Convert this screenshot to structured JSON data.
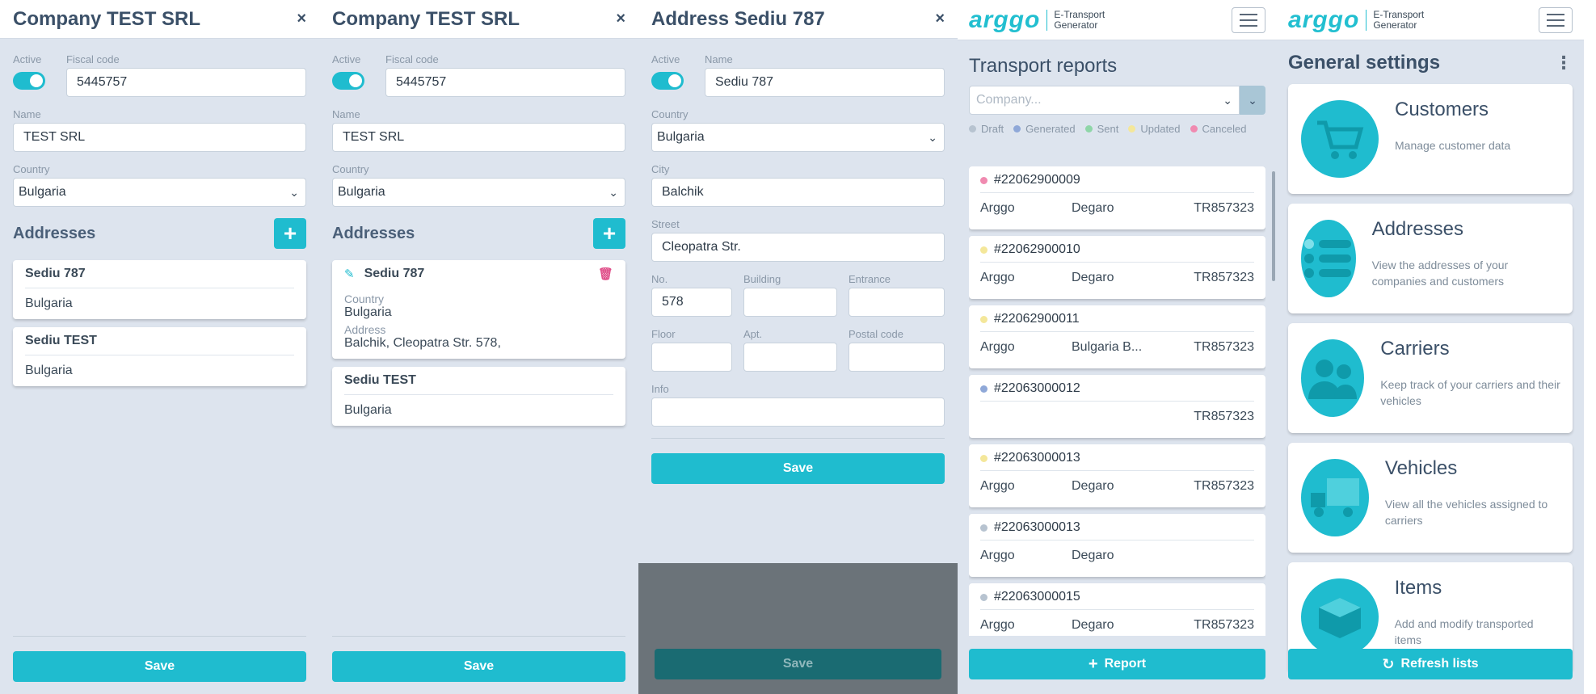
{
  "panel1": {
    "title": "Company TEST SRL",
    "close": "×",
    "active_label": "Active",
    "fiscal_label": "Fiscal code",
    "fiscal_value": "5445757",
    "name_label": "Name",
    "name_value": "TEST SRL",
    "country_label": "Country",
    "country_value": "Bulgaria",
    "addresses_label": "Addresses",
    "addresses": [
      {
        "title": "Sediu 787",
        "country": "Bulgaria"
      },
      {
        "title": "Sediu TEST",
        "country": "Bulgaria"
      }
    ],
    "save_label": "Save"
  },
  "panel2": {
    "title": "Company TEST SRL",
    "close": "×",
    "active_label": "Active",
    "fiscal_label": "Fiscal code",
    "fiscal_value": "5445757",
    "name_label": "Name",
    "name_value": "TEST SRL",
    "country_label": "Country",
    "country_value": "Bulgaria",
    "addresses_label": "Addresses",
    "expanded": {
      "title": "Sediu 787",
      "country_label": "Country",
      "country_value": "Bulgaria",
      "address_label": "Address",
      "address_value": "Balchik, Cleopatra Str. 578,"
    },
    "second": {
      "title": "Sediu TEST",
      "country": "Bulgaria"
    },
    "save_label": "Save"
  },
  "panel3": {
    "title": "Address Sediu 787",
    "close": "×",
    "active_label": "Active",
    "name_label": "Name",
    "name_value": "Sediu 787",
    "country_label": "Country",
    "country_value": "Bulgaria",
    "city_label": "City",
    "city_value": "Balchik",
    "street_label": "Street",
    "street_value": "Cleopatra Str.",
    "no_label": "No.",
    "no_value": "578",
    "building_label": "Building",
    "entrance_label": "Entrance",
    "floor_label": "Floor",
    "apt_label": "Apt.",
    "postal_label": "Postal code",
    "info_label": "Info",
    "save_label": "Save",
    "bg_save_label": "Save"
  },
  "panel4": {
    "logo": "arggo",
    "logo_sub1": "E-Transport",
    "logo_sub2": "Generator",
    "page_title": "Transport reports",
    "company_placeholder": "Company...",
    "legend": [
      {
        "label": "Draft",
        "color": "#b7c3d0"
      },
      {
        "label": "Generated",
        "color": "#8fa8d8"
      },
      {
        "label": "Sent",
        "color": "#8fd6a8"
      },
      {
        "label": "Updated",
        "color": "#f4e79a"
      },
      {
        "label": "Canceled",
        "color": "#f08ab0"
      }
    ],
    "reports": [
      {
        "id": "#22062900009",
        "color": "#f08ab0",
        "a": "Arggo",
        "b": "Degaro",
        "c": "TR857323"
      },
      {
        "id": "#22062900010",
        "color": "#f4e79a",
        "a": "Arggo",
        "b": "Degaro",
        "c": "TR857323"
      },
      {
        "id": "#22062900011",
        "color": "#f4e79a",
        "a": "Arggo",
        "b": "Bulgaria B...",
        "c": "TR857323"
      },
      {
        "id": "#22063000012",
        "color": "#8fa8d8",
        "a": "",
        "b": "",
        "c": "TR857323"
      },
      {
        "id": "#22063000013",
        "color": "#f4e79a",
        "a": "Arggo",
        "b": "Degaro",
        "c": "TR857323"
      },
      {
        "id": "#22063000013",
        "color": "#b7c3d0",
        "a": "Arggo",
        "b": "Degaro",
        "c": ""
      },
      {
        "id": "#22063000015",
        "color": "#b7c3d0",
        "a": "Arggo",
        "b": "Degaro",
        "c": "TR857323"
      }
    ],
    "report_button": "Report"
  },
  "panel5": {
    "logo": "arggo",
    "logo_sub1": "E-Transport",
    "logo_sub2": "Generator",
    "title": "General settings",
    "menu": "⋮",
    "cards": [
      {
        "icon": "cart-icon",
        "title": "Customers",
        "desc": "Manage customer data"
      },
      {
        "icon": "list-icon",
        "title": "Addresses",
        "desc": "View the addresses of your companies and customers"
      },
      {
        "icon": "people-icon",
        "title": "Carriers",
        "desc": "Keep track of your carriers and their vehicles"
      },
      {
        "icon": "truck-icon",
        "title": "Vehicles",
        "desc": "View all the vehicles assigned to carriers"
      },
      {
        "icon": "box-icon",
        "title": "Items",
        "desc": "Add and modify transported items"
      }
    ],
    "refresh_button": "Refresh lists"
  }
}
